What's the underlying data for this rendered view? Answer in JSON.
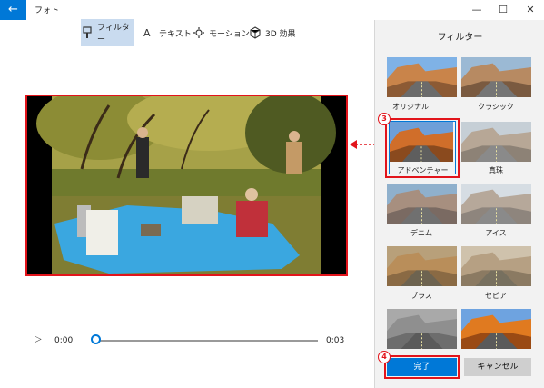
{
  "app": {
    "title": "フォト"
  },
  "window": {
    "minimize": "—",
    "maximize": "☐",
    "close": "✕"
  },
  "toolbar": {
    "filter": "フィルター",
    "text": "テキスト",
    "motion": "モーション",
    "effects3d": "3D 効果"
  },
  "player": {
    "current_time": "0:00",
    "end_time": "0:03",
    "progress": 0
  },
  "panel": {
    "title": "フィルター",
    "filters": [
      {
        "label": "オリジナル",
        "selected": false
      },
      {
        "label": "クラシック",
        "selected": false
      },
      {
        "label": "アドベンチャー",
        "selected": true
      },
      {
        "label": "真珠",
        "selected": false
      },
      {
        "label": "デニム",
        "selected": false
      },
      {
        "label": "アイス",
        "selected": false
      },
      {
        "label": "ブラス",
        "selected": false
      },
      {
        "label": "セピア",
        "selected": false
      },
      {
        "label": "",
        "selected": false
      },
      {
        "label": "",
        "selected": false
      }
    ],
    "done": "完了",
    "cancel": "キャンセル"
  },
  "annotations": {
    "step3": "3",
    "step4": "4"
  },
  "colors": {
    "accent": "#0078d7",
    "highlight": "#e2141b",
    "selection": "#c9dbef"
  }
}
